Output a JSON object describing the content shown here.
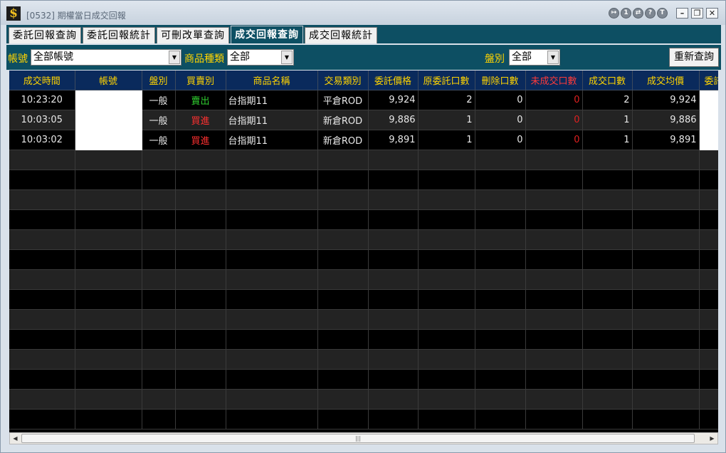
{
  "window": {
    "title": "[0532] 期權當日成交回報",
    "icon_glyph": "$",
    "controls": [
      "↦",
      "1",
      "⇄",
      "?",
      "T"
    ],
    "min": "–",
    "max": "❐",
    "close": "✕"
  },
  "tabs": [
    {
      "label": "委託回報查詢",
      "active": false
    },
    {
      "label": "委託回報統計",
      "active": false
    },
    {
      "label": "可刪改單查詢",
      "active": false
    },
    {
      "label": "成交回報查詢",
      "active": true
    },
    {
      "label": "成交回報統計",
      "active": false
    }
  ],
  "filters": {
    "account_label": "帳號",
    "account_value": "全部帳號",
    "product_label": "商品種類",
    "product_value": "全部",
    "session_label": "盤別",
    "session_value": "全部",
    "requery_label": "重新查詢"
  },
  "columns": [
    "成交時間",
    "帳號",
    "盤別",
    "買賣別",
    "商品名稱",
    "交易類別",
    "委託價格",
    "原委託口數",
    "刪除口數",
    "未成交口數",
    "成交口數",
    "成交均價",
    "委託"
  ],
  "rows": [
    {
      "time": "10:23:20",
      "account": "",
      "session": "一般",
      "side": "賣出",
      "side_type": "sell",
      "product": "台指期11",
      "trade_type": "平倉ROD",
      "price": "9,924",
      "orig_qty": "2",
      "del_qty": "0",
      "unfilled": "0",
      "filled": "2",
      "avg_price": "9,924"
    },
    {
      "time": "10:03:05",
      "account": "",
      "session": "一般",
      "side": "買進",
      "side_type": "buy",
      "product": "台指期11",
      "trade_type": "新倉ROD",
      "price": "9,886",
      "orig_qty": "1",
      "del_qty": "0",
      "unfilled": "0",
      "filled": "1",
      "avg_price": "9,886"
    },
    {
      "time": "10:03:02",
      "account": "",
      "session": "一般",
      "side": "買進",
      "side_type": "buy",
      "product": "台指期11",
      "trade_type": "新倉ROD",
      "price": "9,891",
      "orig_qty": "1",
      "del_qty": "0",
      "unfilled": "0",
      "filled": "1",
      "avg_price": "9,891"
    }
  ],
  "empty_row_count": 14,
  "scroll": {
    "left": "◀",
    "right": "▶",
    "grip": "|||"
  },
  "colors": {
    "header_bg": "#0a2a5c",
    "header_text": "#ffd400",
    "panel": "#0d4f63",
    "sell": "#30d030",
    "buy": "#ff3030"
  }
}
